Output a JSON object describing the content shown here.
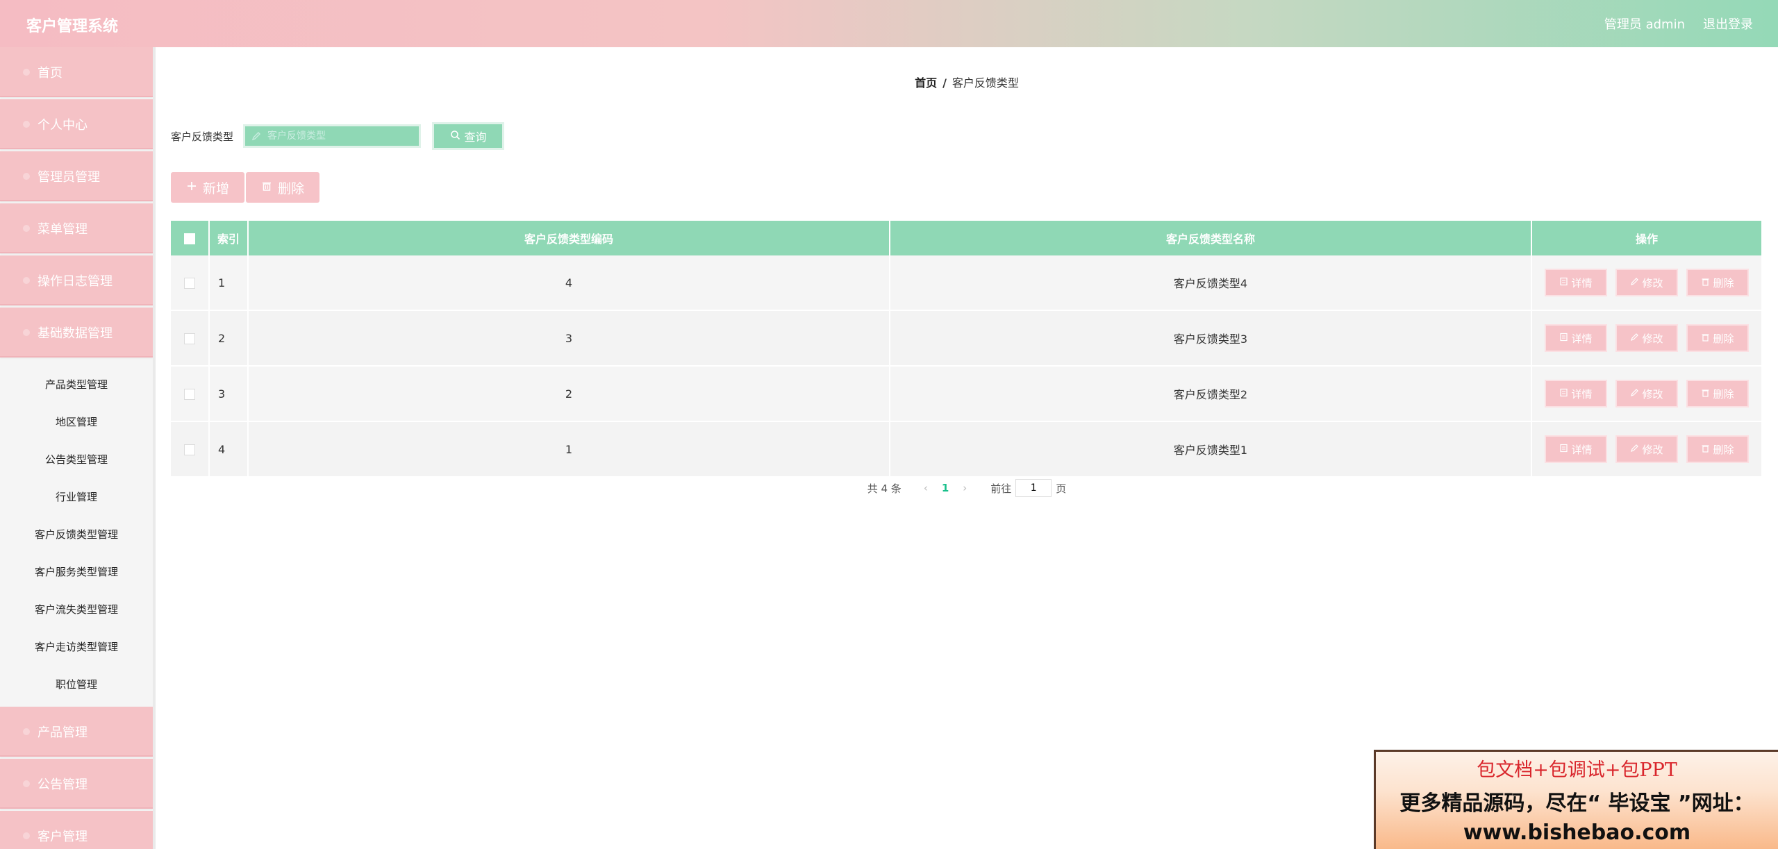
{
  "header": {
    "title": "客户管理系统",
    "user": "管理员 admin",
    "logout": "退出登录"
  },
  "sidebar": {
    "top_items": [
      "首页",
      "个人中心",
      "管理员管理",
      "菜单管理",
      "操作日志管理",
      "基础数据管理"
    ],
    "sub_items": [
      "产品类型管理",
      "地区管理",
      "公告类型管理",
      "行业管理",
      "客户反馈类型管理",
      "客户服务类型管理",
      "客户流失类型管理",
      "客户走访类型管理",
      "职位管理"
    ],
    "bottom_items": [
      "产品管理",
      "公告管理",
      "客户管理"
    ]
  },
  "breadcrumb": {
    "home": "首页",
    "sep": "/",
    "current": "客户反馈类型"
  },
  "search": {
    "label": "客户反馈类型",
    "placeholder": "客户反馈类型",
    "button": "查询"
  },
  "actions": {
    "add": "新增",
    "delete": "删除"
  },
  "table": {
    "headers": {
      "index": "索引",
      "code": "客户反馈类型编码",
      "name": "客户反馈类型名称",
      "ops": "操作"
    },
    "rows": [
      {
        "index": "1",
        "code": "4",
        "name": "客户反馈类型4"
      },
      {
        "index": "2",
        "code": "3",
        "name": "客户反馈类型3"
      },
      {
        "index": "3",
        "code": "2",
        "name": "客户反馈类型2"
      },
      {
        "index": "4",
        "code": "1",
        "name": "客户反馈类型1"
      }
    ],
    "ops": {
      "detail": "详情",
      "edit": "修改",
      "delete": "删除"
    }
  },
  "pagination": {
    "total": "共 4 条",
    "current": "1",
    "goto_prefix": "前往",
    "goto_value": "1",
    "goto_suffix": "页"
  },
  "ad": {
    "line1": "包文档+包调试+包PPT",
    "line2": "更多精品源码，尽在“ 毕设宝 ”网址：",
    "line3": "www.bishebao.com"
  },
  "colors": {
    "pink": "#f5c2c6",
    "green": "#8fd8b5",
    "accent": "#19c08b"
  }
}
